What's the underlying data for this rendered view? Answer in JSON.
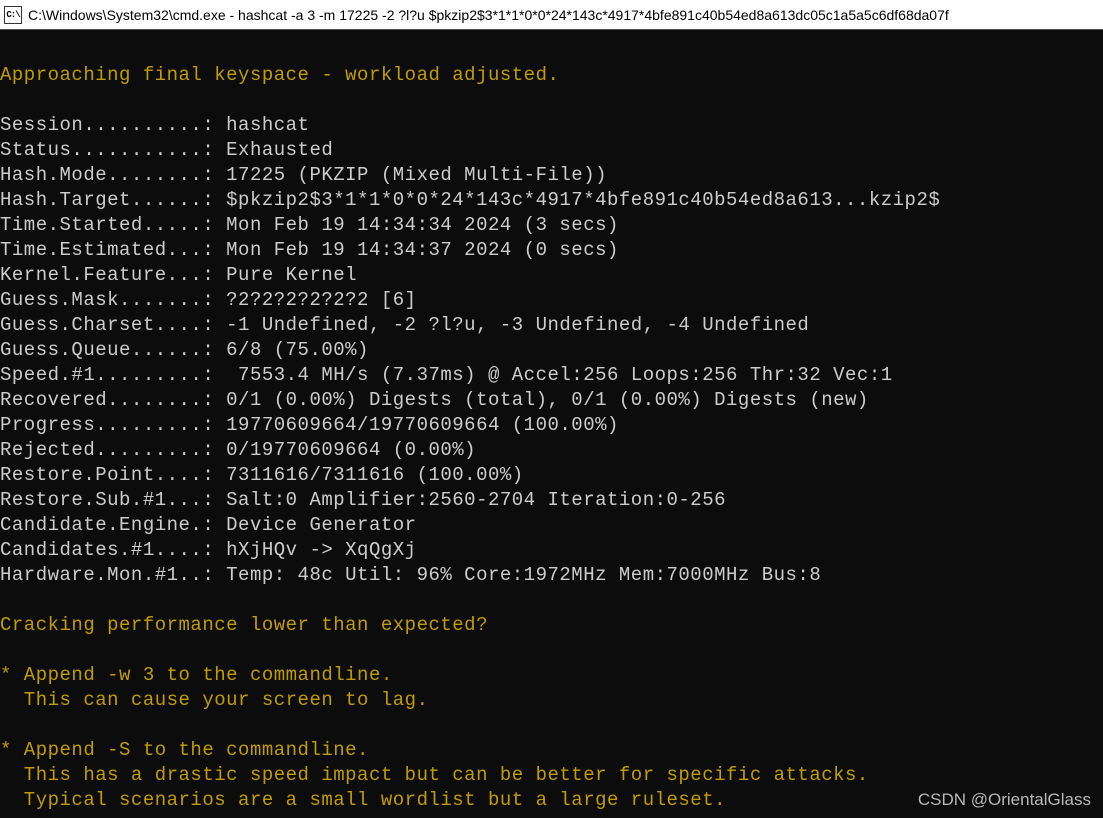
{
  "window": {
    "icon_label": "C:\\",
    "title": "C:\\Windows\\System32\\cmd.exe - hashcat  -a 3 -m 17225 -2 ?l?u $pkzip2$3*1*1*0*0*24*143c*4917*4bfe891c40b54ed8a613dc05c1a5a5c6df68da07f"
  },
  "banner": "Approaching final keyspace - workload adjusted.",
  "status_rows": [
    {
      "label": "Session..........",
      "value": "hashcat"
    },
    {
      "label": "Status...........",
      "value": "Exhausted"
    },
    {
      "label": "Hash.Mode........",
      "value": "17225 (PKZIP (Mixed Multi-File))"
    },
    {
      "label": "Hash.Target......",
      "value": "$pkzip2$3*1*1*0*0*24*143c*4917*4bfe891c40b54ed8a613...kzip2$"
    },
    {
      "label": "Time.Started.....",
      "value": "Mon Feb 19 14:34:34 2024 (3 secs)"
    },
    {
      "label": "Time.Estimated...",
      "value": "Mon Feb 19 14:34:37 2024 (0 secs)"
    },
    {
      "label": "Kernel.Feature...",
      "value": "Pure Kernel"
    },
    {
      "label": "Guess.Mask.......",
      "value": "?2?2?2?2?2?2 [6]"
    },
    {
      "label": "Guess.Charset....",
      "value": "-1 Undefined, -2 ?l?u, -3 Undefined, -4 Undefined"
    },
    {
      "label": "Guess.Queue......",
      "value": "6/8 (75.00%)"
    },
    {
      "label": "Speed.#1.........",
      "value": " 7553.4 MH/s (7.37ms) @ Accel:256 Loops:256 Thr:32 Vec:1"
    },
    {
      "label": "Recovered........",
      "value": "0/1 (0.00%) Digests (total), 0/1 (0.00%) Digests (new)"
    },
    {
      "label": "Progress.........",
      "value": "19770609664/19770609664 (100.00%)"
    },
    {
      "label": "Rejected.........",
      "value": "0/19770609664 (0.00%)"
    },
    {
      "label": "Restore.Point....",
      "value": "7311616/7311616 (100.00%)"
    },
    {
      "label": "Restore.Sub.#1...",
      "value": "Salt:0 Amplifier:2560-2704 Iteration:0-256"
    },
    {
      "label": "Candidate.Engine.",
      "value": "Device Generator"
    },
    {
      "label": "Candidates.#1....",
      "value": "hXjHQv -> XqQgXj"
    },
    {
      "label": "Hardware.Mon.#1..",
      "value": "Temp: 48c Util: 96% Core:1972MHz Mem:7000MHz Bus:8"
    }
  ],
  "perf_header": "Cracking performance lower than expected?",
  "tips": [
    {
      "bullet": "* Append -w 3 to the commandline.",
      "lines": [
        "  This can cause your screen to lag."
      ]
    },
    {
      "bullet": "* Append -S to the commandline.",
      "lines": [
        "  This has a drastic speed impact but can be better for specific attacks.",
        "  Typical scenarios are a small wordlist but a large ruleset."
      ]
    }
  ],
  "watermark": "CSDN @OrientalGlass"
}
